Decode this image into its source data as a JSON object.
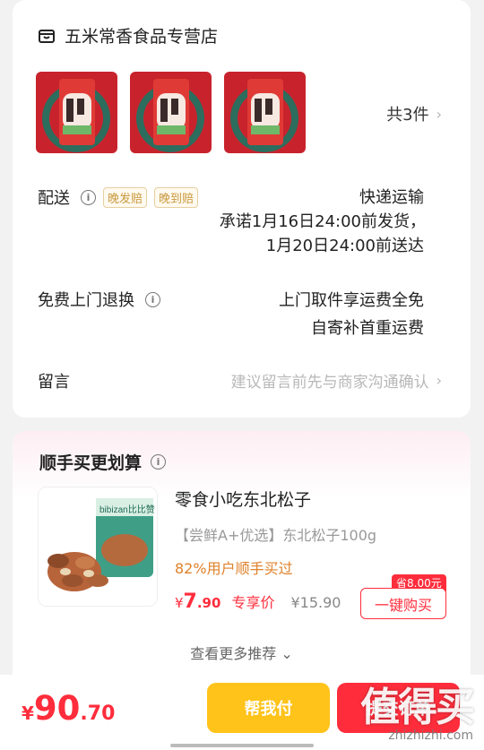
{
  "store": {
    "name": "五米常香食品专营店",
    "icon": "store-icon"
  },
  "order": {
    "count_label": "共3件",
    "chevron": "›",
    "delivery": {
      "label": "配送",
      "tags": [
        "晚发赔",
        "晚到赔"
      ],
      "method": "快递运输",
      "promise_line1": "承诺1月16日24:00前发货，",
      "promise_line2": "1月20日24:00前送达"
    },
    "returns": {
      "label": "免费上门退换",
      "line1": "上门取件享运费全免",
      "line2": "自寄补首重运费"
    },
    "memo": {
      "label": "留言",
      "placeholder": "建议留言前先与商家沟通确认"
    }
  },
  "recommend": {
    "title": "顺手买更划算",
    "product": {
      "name": "零食小吃东北松子",
      "desc": "【尝鲜A+优选】东北松子100g",
      "social": "82%用户顺手买过",
      "price_symbol": "¥",
      "price_int": "7",
      "price_dec": ".90",
      "price_tag": "专享价",
      "orig_price": "¥15.90",
      "save": "省8.00元",
      "buy_label": "一键购买",
      "package_brand": "bibizan比比赞"
    },
    "more": "查看更多推荐 ⌄"
  },
  "bottom": {
    "symbol": "¥",
    "total_int": "90",
    "total_dec": ".70",
    "help_label": "帮我付",
    "pay_label": "提交订单",
    "watermark": "值得买",
    "watermark_url": "zhizhizhi.com"
  },
  "colors": {
    "accent": "#ff2d3c",
    "yellow": "#ffc31a",
    "tag_gold": "#c99a3f"
  }
}
